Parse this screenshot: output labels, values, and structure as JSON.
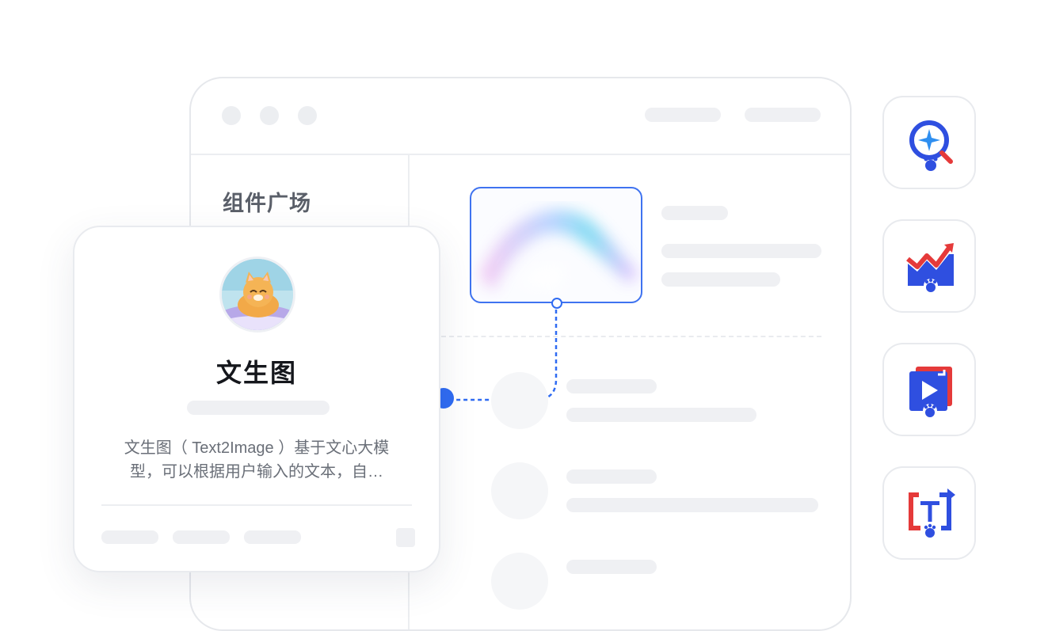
{
  "sidebar": {
    "title": "组件广场"
  },
  "component_card": {
    "title": "文生图",
    "description_lines": [
      "文生图（ Text2Image ）基于文心大模",
      "型，可以根据用户输入的文本，自…"
    ]
  },
  "colors": {
    "accent": "#2f6bf2",
    "logo_blue": "#2f4fe0",
    "logo_red": "#e53a3a"
  },
  "apps": [
    {
      "icon": "ai-search-icon"
    },
    {
      "icon": "trend-chart-icon"
    },
    {
      "icon": "video-play-icon"
    },
    {
      "icon": "text-translate-icon"
    }
  ]
}
